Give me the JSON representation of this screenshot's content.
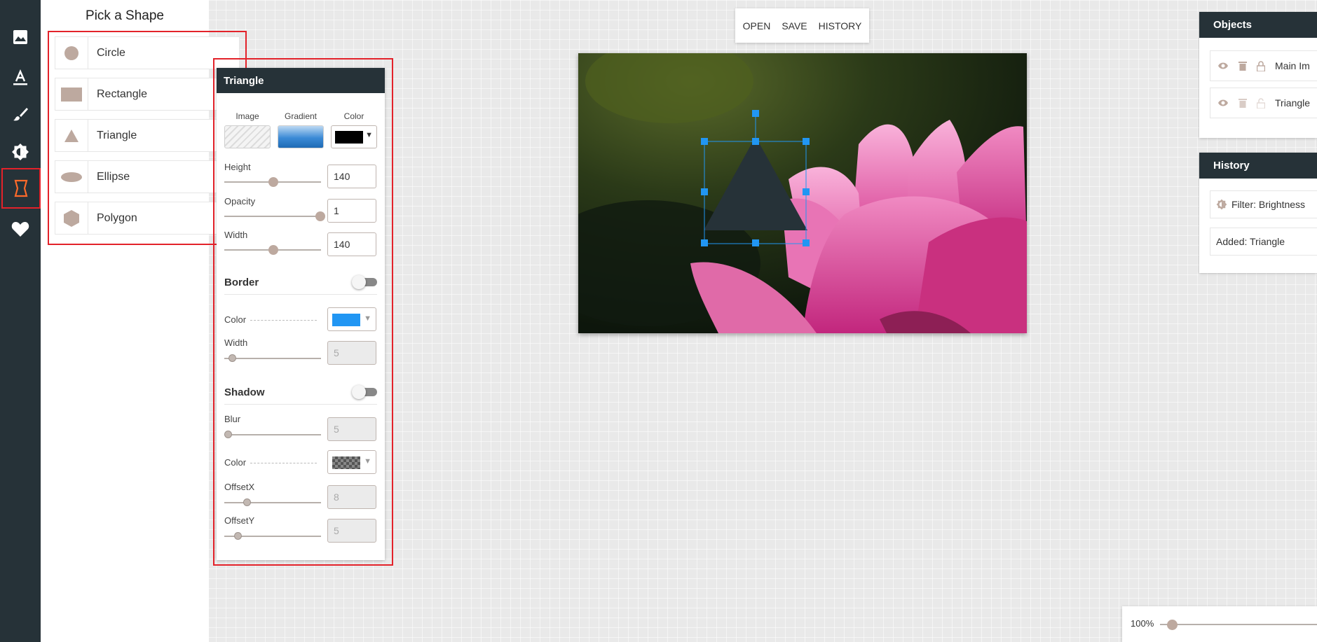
{
  "rail": {
    "items": [
      {
        "icon": "image-icon",
        "active": false
      },
      {
        "icon": "text-icon",
        "active": false
      },
      {
        "icon": "brush-icon",
        "active": false
      },
      {
        "icon": "brightness-icon",
        "active": false
      },
      {
        "icon": "shape-icon",
        "active": true
      },
      {
        "icon": "heart-icon",
        "active": false
      }
    ]
  },
  "picker": {
    "title": "Pick a Shape",
    "shapes": [
      {
        "label": "Circle",
        "icon": "circle-icon"
      },
      {
        "label": "Rectangle",
        "icon": "rectangle-icon"
      },
      {
        "label": "Triangle",
        "icon": "triangle-icon"
      },
      {
        "label": "Ellipse",
        "icon": "ellipse-icon"
      },
      {
        "label": "Polygon",
        "icon": "polygon-icon"
      }
    ]
  },
  "props": {
    "title": "Triangle",
    "fill": {
      "image_label": "Image",
      "gradient_label": "Gradient",
      "color_label": "Color",
      "color_value": "#000000"
    },
    "height": {
      "label": "Height",
      "value": "140",
      "level": 0.5
    },
    "opacity": {
      "label": "Opacity",
      "value": "1",
      "level": 1.0
    },
    "width": {
      "label": "Width",
      "value": "140",
      "level": 0.5
    },
    "border": {
      "title": "Border",
      "enabled": false,
      "color_label": "Color",
      "color_value": "#2196f3",
      "width_label": "Width",
      "width_value": "5"
    },
    "shadow": {
      "title": "Shadow",
      "enabled": false,
      "blur_label": "Blur",
      "blur_value": "5",
      "color_label": "Color",
      "offsetx_label": "OffsetX",
      "offsetx_value": "8",
      "offsety_label": "OffsetY",
      "offsety_value": "5"
    }
  },
  "toolbar": {
    "open_label": "OPEN",
    "save_label": "SAVE",
    "history_label": "HISTORY"
  },
  "objects": {
    "title": "Objects",
    "items": [
      {
        "label": "Main Im"
      },
      {
        "label": "Triangle"
      }
    ]
  },
  "history": {
    "title": "History",
    "items": [
      {
        "label": "Filter: Brightness",
        "icon": "brightness-icon"
      },
      {
        "label": "Added: Triangle"
      }
    ]
  },
  "zoom": {
    "value": "100%"
  },
  "colors": {
    "accent": "#263238",
    "highlight": "#e3222a",
    "shape_fill": "#bda99f",
    "selection": "#2196f3"
  }
}
